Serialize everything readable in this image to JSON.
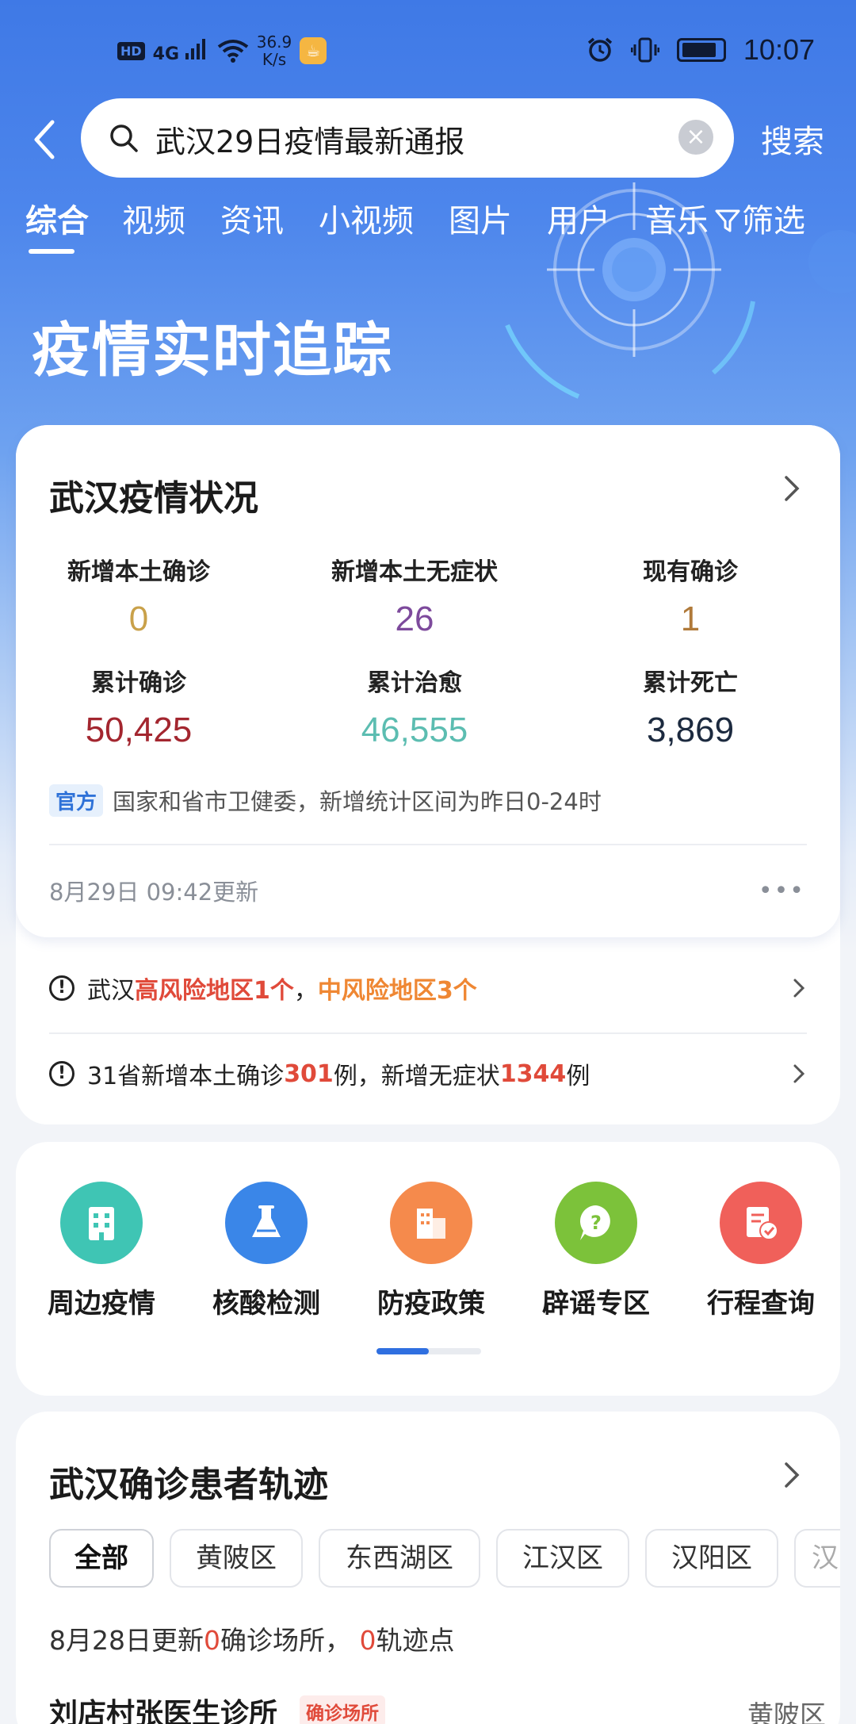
{
  "status_bar": {
    "hd": "HD",
    "network": "4G",
    "speed_value": "36.9",
    "speed_unit": "K/s",
    "time": "10:07"
  },
  "search": {
    "query": "武汉29日疫情最新通报",
    "submit_label": "搜索"
  },
  "tabs": [
    "综合",
    "视频",
    "资讯",
    "小视频",
    "图片",
    "用户",
    "音乐"
  ],
  "filter_label": "筛选",
  "hero_title": "疫情实时追踪",
  "status_card": {
    "title": "武汉疫情状况",
    "stats": [
      {
        "label": "新增本土确诊",
        "value": "0",
        "color": "#c9a14a"
      },
      {
        "label": "新增本土无症状",
        "value": "26",
        "color": "#7d4a9c"
      },
      {
        "label": "现有确诊",
        "value": "1",
        "color": "#b07a3a"
      },
      {
        "label": "累计确诊",
        "value": "50,425",
        "color": "#a3262f"
      },
      {
        "label": "累计治愈",
        "value": "46,555",
        "color": "#5cbdb1"
      },
      {
        "label": "累计死亡",
        "value": "3,869",
        "color": "#1c2a3f"
      }
    ],
    "official_tag": "官方",
    "official_text": "国家和省市卫健委，新增统计区间为昨日0-24时",
    "update_time": "8月29日 09:42更新",
    "more": "..."
  },
  "alerts": {
    "risk": {
      "prefix": "武汉",
      "high": "高风险地区1个",
      "sep": "，",
      "mid": "中风险地区3个"
    },
    "national": {
      "p1": "31省新增本土确诊",
      "n1": "301",
      "p2": "例，新增无症状",
      "n2": "1344",
      "p3": "例"
    }
  },
  "services": [
    {
      "label": "周边疫情",
      "icon": "building-icon",
      "color": "#3fc5b4"
    },
    {
      "label": "核酸检测",
      "icon": "flask-icon",
      "color": "#3a86e8"
    },
    {
      "label": "防疫政策",
      "icon": "office-icon",
      "color": "#f58a4c"
    },
    {
      "label": "辟谣专区",
      "icon": "question-bubble-icon",
      "color": "#7cc23a"
    },
    {
      "label": "行程查询",
      "icon": "itinerary-icon",
      "color": "#f0605a"
    }
  ],
  "trajectory": {
    "title": "武汉确诊患者轨迹",
    "chips": [
      "全部",
      "黄陂区",
      "东西湖区",
      "江汉区",
      "汉阳区",
      "汉"
    ],
    "summary_prefix": "8月28日更新",
    "sites_count": "0",
    "sites_label": "确诊场所，",
    "points_count": "0",
    "points_label": "轨迹点",
    "place": {
      "name": "刘店村张医生诊所",
      "tag": "确诊场所",
      "district": "黄陂区"
    }
  }
}
